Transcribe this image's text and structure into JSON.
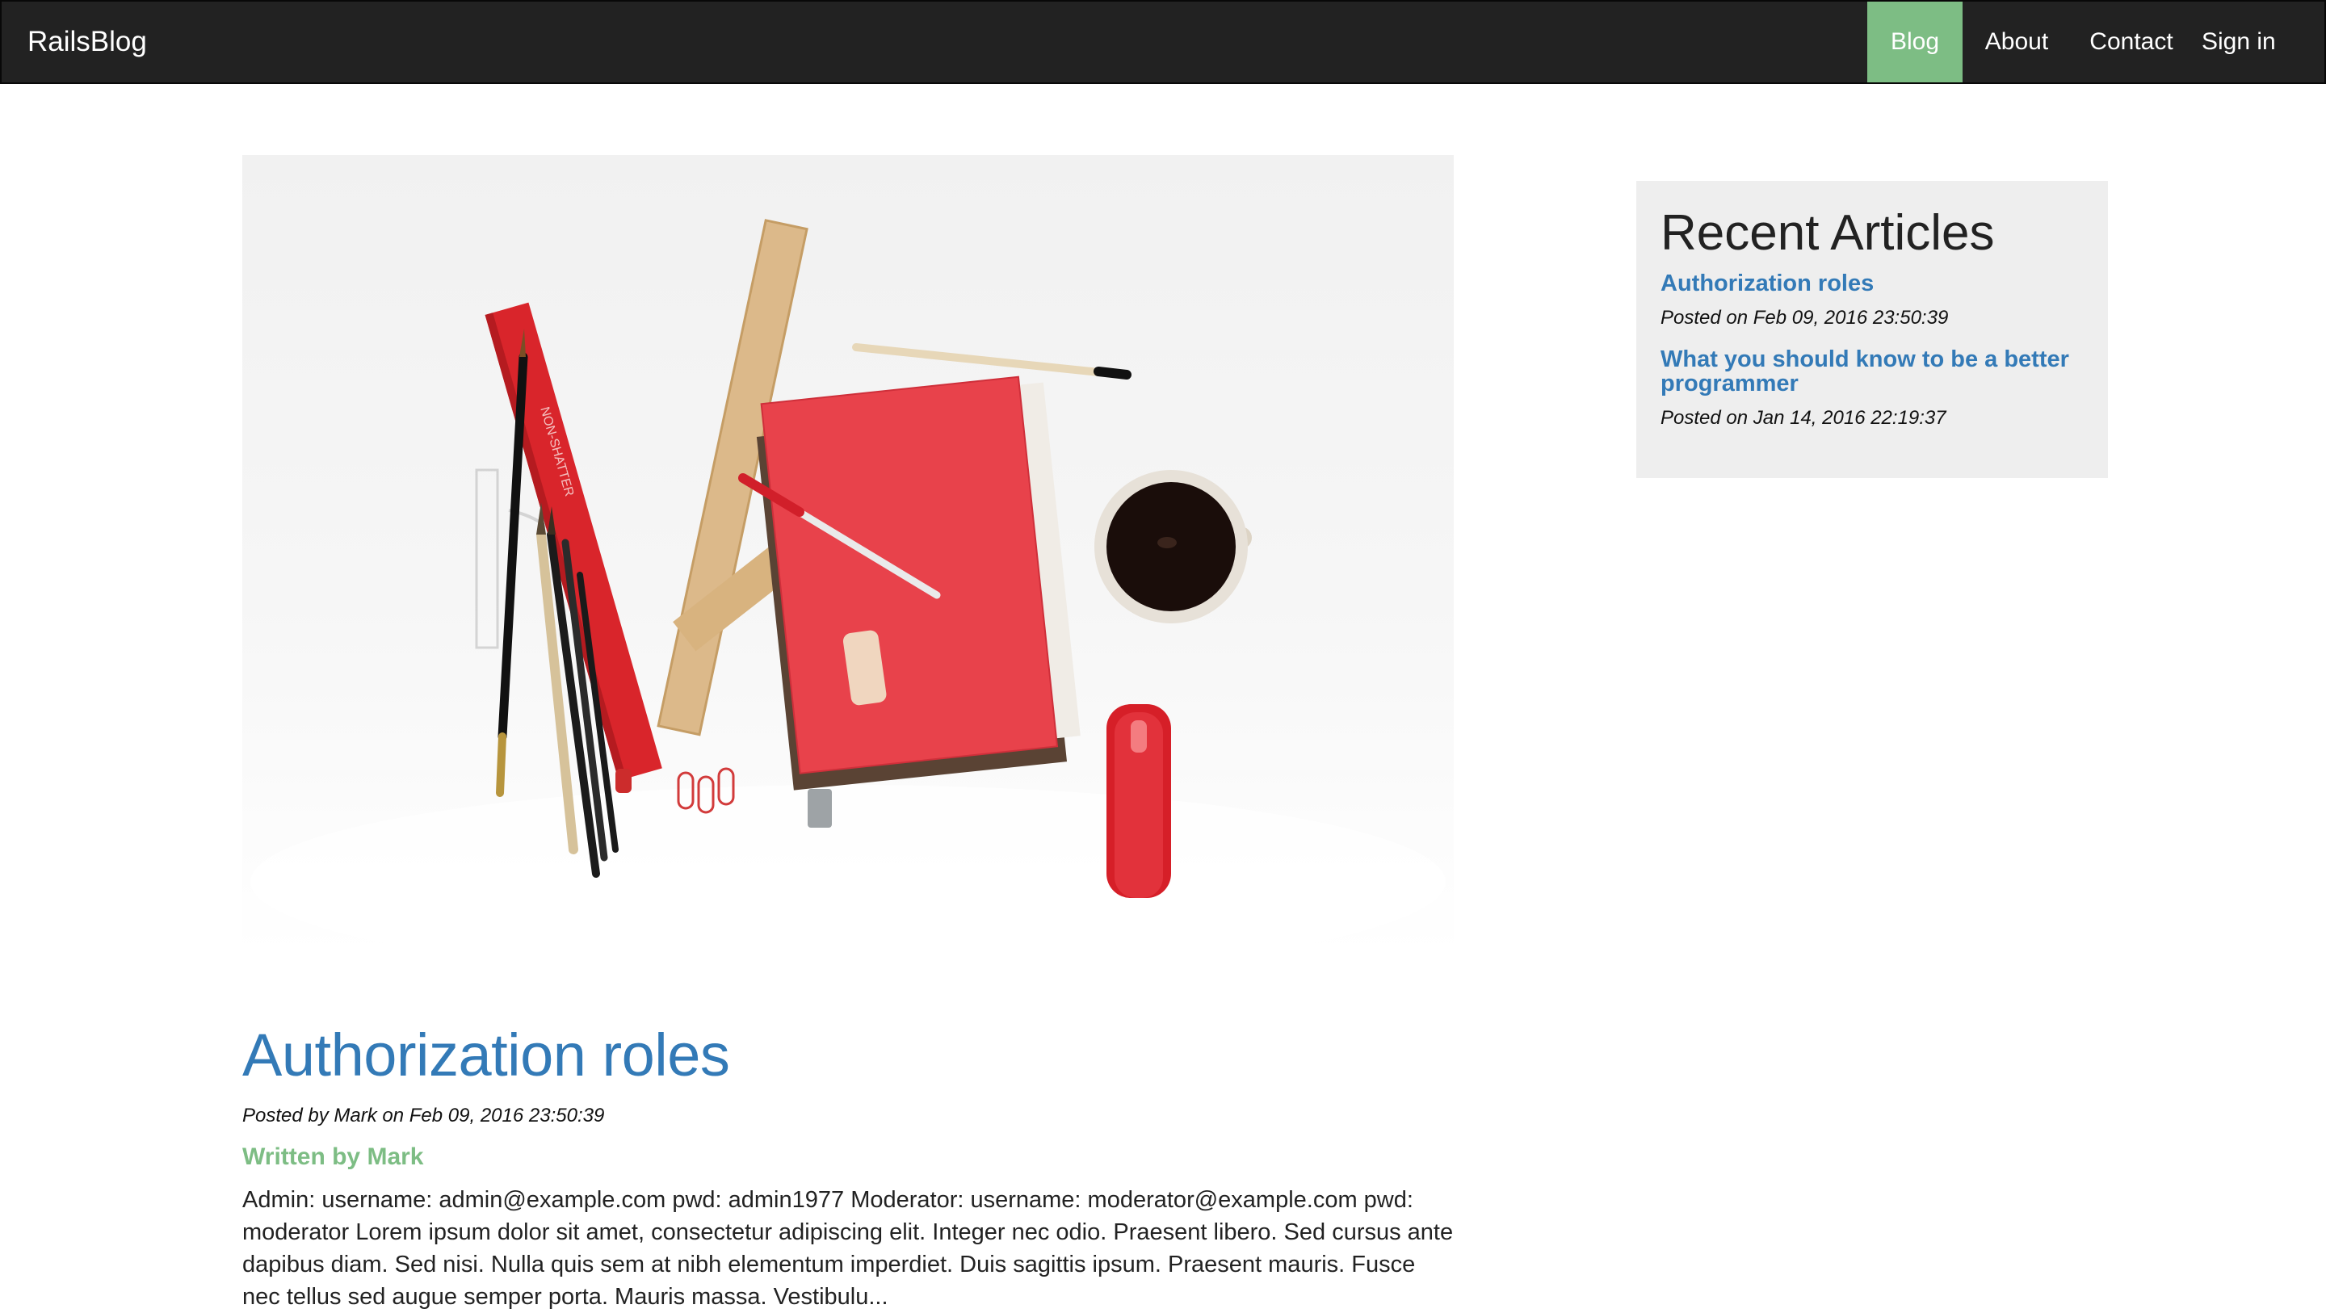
{
  "navbar": {
    "brand": "RailsBlog",
    "links": [
      {
        "label": "Blog",
        "active": true
      },
      {
        "label": "About",
        "active": false
      },
      {
        "label": "Contact",
        "active": false
      },
      {
        "label": "Sign in",
        "active": false
      }
    ]
  },
  "colors": {
    "navbar_bg": "#222222",
    "accent_green": "#7dbd84",
    "link_blue": "#337ab7",
    "sidebar_bg": "#eeeeee"
  },
  "post": {
    "title": "Authorization roles",
    "meta": "Posted by Mark on Feb 09, 2016 23:50:39",
    "author": "Written by Mark",
    "body": "Admin: username: admin@example.com pwd: admin1977 Moderator: username: moderator@example.com pwd: moderator Lorem ipsum dolor sit amet, consectetur adipiscing elit. Integer nec odio. Praesent libero. Sed cursus ante dapibus diam. Sed nisi. Nulla quis sem at nibh elementum imperdiet. Duis sagittis ipsum. Praesent mauris. Fusce nec tellus sed augue semper porta. Mauris massa. Vestibulu..."
  },
  "sidebar": {
    "title": "Recent Articles",
    "articles": [
      {
        "title": "Authorization roles",
        "date": "Posted on Feb 09, 2016 23:50:39"
      },
      {
        "title": "What you should know to be a better programmer",
        "date": "Posted on Jan 14, 2016 22:19:37"
      }
    ]
  }
}
